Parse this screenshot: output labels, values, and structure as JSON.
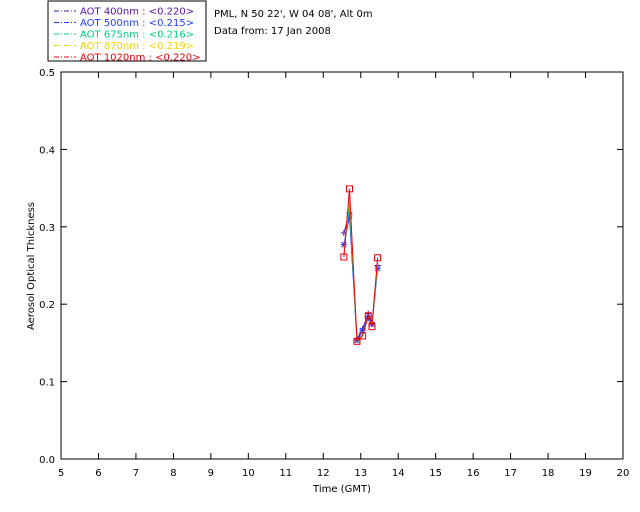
{
  "header": {
    "site_line": "PML, N 50 22', W 04 08', Alt 0m",
    "date_line": "Data from: 17 Jan 2008"
  },
  "chart_data": {
    "type": "line",
    "xlabel": "Time (GMT)",
    "ylabel": "Aerosol Optical Thickness",
    "xlim": [
      5,
      20
    ],
    "ylim": [
      0.0,
      0.5
    ],
    "xticks": [
      5,
      6,
      7,
      8,
      9,
      10,
      11,
      12,
      13,
      14,
      15,
      16,
      17,
      18,
      19,
      20
    ],
    "yticks": [
      0.0,
      0.1,
      0.2,
      0.3,
      0.4,
      0.5
    ],
    "ytick_labels": [
      "0.0",
      "0.1",
      "0.2",
      "0.3",
      "0.4",
      "0.5"
    ],
    "grid": false,
    "legend_position": "top-left-outside",
    "series": [
      {
        "name": "AOT  400nm : <0.220>",
        "color": "#5a0fa0",
        "marker": "plus",
        "x": [
          12.55,
          12.7,
          12.9,
          13.05,
          13.2,
          13.3,
          13.45
        ],
        "y": [
          0.292,
          0.318,
          0.155,
          0.168,
          0.188,
          0.176,
          0.25
        ]
      },
      {
        "name": "AOT  500nm : <0.215>",
        "color": "#1e3cff",
        "marker": "star",
        "x": [
          12.55,
          12.7,
          12.9,
          13.05,
          13.2,
          13.3,
          13.45
        ],
        "y": [
          0.277,
          0.314,
          0.153,
          0.166,
          0.182,
          0.174,
          0.246
        ]
      },
      {
        "name": "AOT  675nm : <0.216>",
        "color": "#00d27a",
        "marker": "none",
        "x": [
          12.55,
          12.7,
          12.9,
          13.05,
          13.2,
          13.3,
          13.45
        ],
        "y": [
          0.266,
          0.33,
          0.15,
          0.162,
          0.183,
          0.173,
          0.252
        ]
      },
      {
        "name": "AOT  870nm : <0.219>",
        "color": "#f0d200",
        "marker": "none",
        "x": [
          12.55,
          12.7,
          12.9,
          13.05,
          13.2,
          13.3,
          13.45
        ],
        "y": [
          0.263,
          0.342,
          0.152,
          0.16,
          0.184,
          0.172,
          0.256
        ]
      },
      {
        "name": "AOT 1020nm : <0.220>",
        "color": "#e8000a",
        "marker": "square",
        "x": [
          12.55,
          12.7,
          12.9,
          13.05,
          13.2,
          13.3,
          13.45
        ],
        "y": [
          0.261,
          0.349,
          0.152,
          0.159,
          0.185,
          0.171,
          0.26
        ]
      }
    ]
  }
}
